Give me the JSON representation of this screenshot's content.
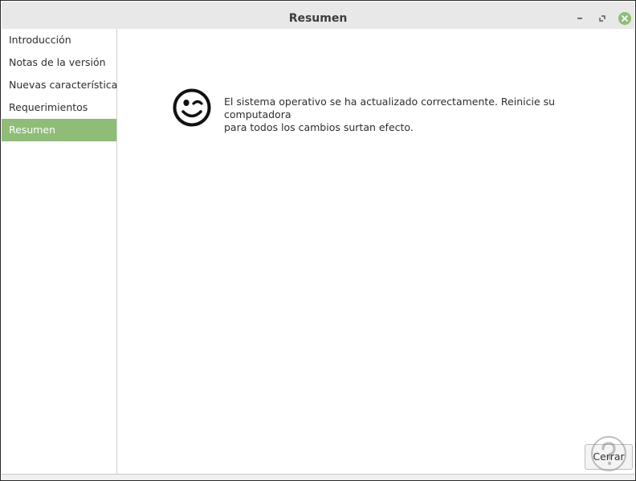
{
  "window": {
    "title": "Resumen"
  },
  "sidebar": {
    "items": [
      {
        "label": "Introducción",
        "active": false
      },
      {
        "label": "Notas de la versión",
        "active": false
      },
      {
        "label": "Nuevas características",
        "active": false
      },
      {
        "label": "Requerimientos",
        "active": false
      },
      {
        "label": "Resumen",
        "active": true
      }
    ]
  },
  "main": {
    "icon": "smiley-wink-icon",
    "message_line1": "El sistema operativo se ha actualizado correctamente. Reinicie su computadora",
    "message_line2": "para todos los cambios surtan efecto."
  },
  "footer": {
    "close_label": "Cerrar"
  },
  "colors": {
    "accent": "#8fbc77",
    "close_button": "#8fbc77"
  }
}
